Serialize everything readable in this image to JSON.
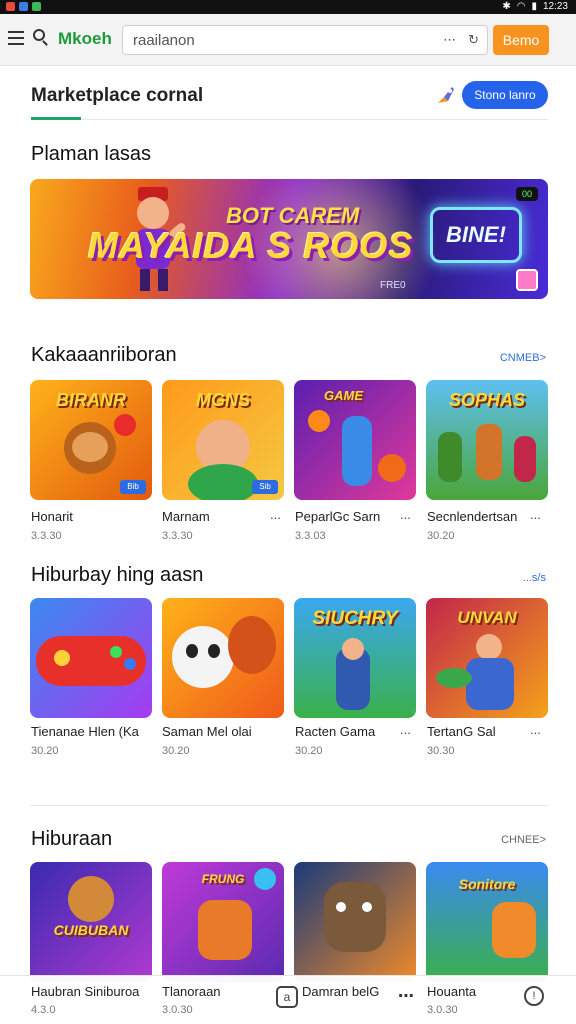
{
  "status_bar": {
    "time": "12:23"
  },
  "toolbar": {
    "brand": "Mkoeh",
    "address": "raailanon",
    "go_label": "Bemo"
  },
  "header": {
    "title": "Marketplace cornal",
    "button_label": "Stono lanro"
  },
  "featured": {
    "section_title": "Plaman lasas",
    "banner": {
      "headline_top": "BOT CAREM",
      "headline": "MAYAIDA S ROOS",
      "logo_text": "BINE!",
      "badge": "00",
      "footnote": "FRE0"
    }
  },
  "sections": [
    {
      "title": "Kakaaanriiboran",
      "see_more": "CNMEB>",
      "items": [
        {
          "name": "Honarit",
          "meta": "3.3.30",
          "art": "BIRANR",
          "tag": "Bib"
        },
        {
          "name": "Marnam",
          "meta": "3.3.30",
          "art": "MGNS",
          "tag": "Sib"
        },
        {
          "name": "PeparlGc Sarn",
          "meta": "3.3.03",
          "art": "GAME",
          "tag": ""
        },
        {
          "name": "Secnlendertsan",
          "meta": "30.20",
          "art": "SOPHAS",
          "tag": ""
        }
      ]
    },
    {
      "title": "Hiburbay hing aasn",
      "see_more": "...s/s",
      "items": [
        {
          "name": "Tienanae Hlen (Ka",
          "meta": "30.20",
          "art": "",
          "tag": ""
        },
        {
          "name": "Saman Mel olai",
          "meta": "30.20",
          "art": "",
          "tag": ""
        },
        {
          "name": "Racten Gama",
          "meta": "30.20",
          "art": "SIUCHRY",
          "tag": ""
        },
        {
          "name": "TertanG Sal",
          "meta": "30.30",
          "art": "UNVAN",
          "tag": ""
        }
      ]
    },
    {
      "title": "Hiburaan",
      "see_more": "CHNEE>",
      "items": [
        {
          "name": "",
          "meta": "",
          "art": "CUIBUBAN",
          "tag": ""
        },
        {
          "name": "",
          "meta": "",
          "art": "FRUNG",
          "tag": ""
        },
        {
          "name": "",
          "meta": "",
          "art": "",
          "tag": ""
        },
        {
          "name": "",
          "meta": "",
          "art": "Sonitore",
          "tag": ""
        }
      ]
    }
  ],
  "bottom_nav": {
    "item1_label": "Haubran Siniburoa",
    "item1_sub": "4.3.0",
    "item2_label": "Tlanoraan",
    "item2_sub": "3.0.30",
    "item3_label": "Damran belG",
    "item4_label": "Houanta",
    "item4_sub": "3.0.30"
  },
  "colors": {
    "accent_green": "#1fa36a",
    "accent_orange": "#f7931e",
    "accent_blue": "#2563eb"
  },
  "icons": [
    "menu-icon",
    "search-icon",
    "refresh-icon",
    "rocket-icon",
    "bookmark-icon",
    "more-icon",
    "help-icon"
  ]
}
